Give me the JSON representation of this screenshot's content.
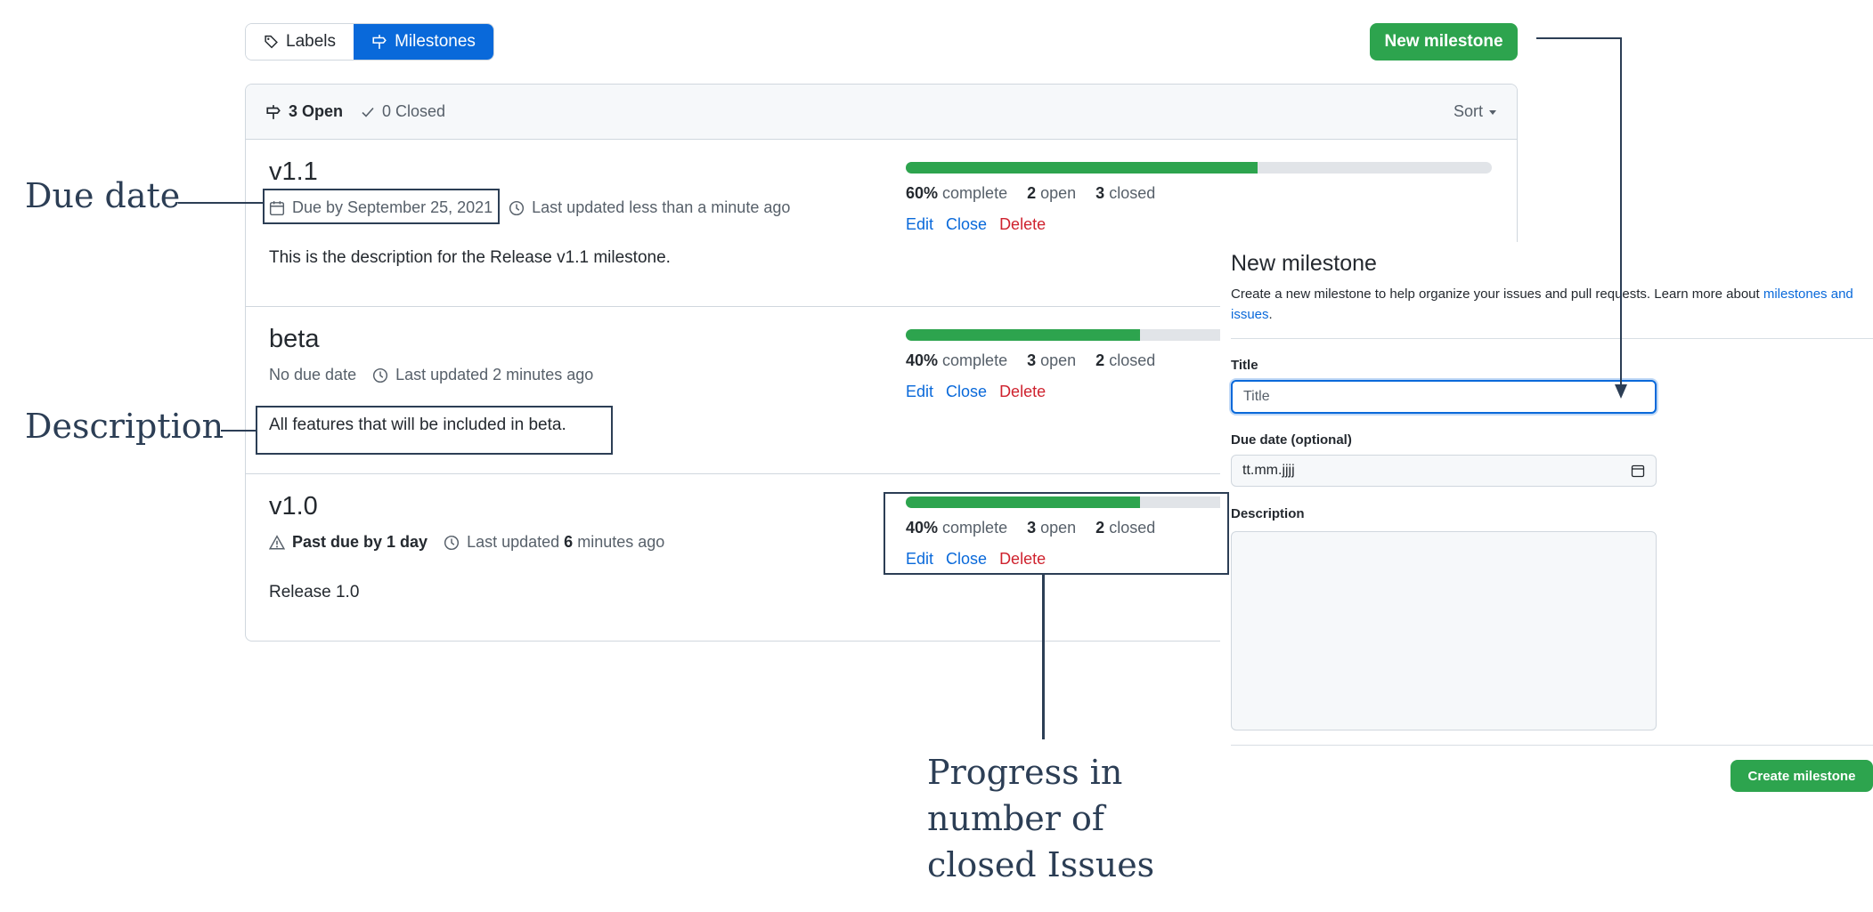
{
  "toggle": {
    "labels": "Labels",
    "milestones": "Milestones"
  },
  "new_milestone_button": "New milestone",
  "list_header": {
    "open": "3 Open",
    "closed": "0 Closed",
    "sort": "Sort"
  },
  "milestones": [
    {
      "title": "v1.1",
      "due": "Due by September 25, 2021",
      "updated": "Last updated less than a minute ago",
      "description": "This is the description for the Release v1.1 milestone.",
      "progress_pct": 60,
      "complete_pct": "60%",
      "complete_label": "complete",
      "open_count": "2",
      "open_label": "open",
      "closed_count": "3",
      "closed_label": "closed"
    },
    {
      "title": "beta",
      "due": "No due date",
      "updated": "Last updated 2 minutes ago",
      "description": "All features that will be included in beta.",
      "progress_pct": 40,
      "complete_pct": "40%",
      "complete_label": "complete",
      "open_count": "3",
      "open_label": "open",
      "closed_count": "2",
      "closed_label": "closed"
    },
    {
      "title": "v1.0",
      "due": "Past due by 1 day",
      "updated_prefix": "Last updated",
      "updated_bold": "6",
      "updated_suffix": "minutes ago",
      "description": "Release 1.0",
      "progress_pct": 40,
      "complete_pct": "40%",
      "complete_label": "complete",
      "open_count": "3",
      "open_label": "open",
      "closed_count": "2",
      "closed_label": "closed"
    }
  ],
  "actions": {
    "edit": "Edit",
    "close": "Close",
    "delete": "Delete"
  },
  "annotations": {
    "due_date": "Due date",
    "description": "Description",
    "progress": [
      "Progress in",
      "number of",
      "closed Issues"
    ]
  },
  "new_milestone_form": {
    "heading": "New milestone",
    "subtitle": "Create a new milestone to help organize your issues and pull requests. Learn more about",
    "subtitle_link": "milestones and issues",
    "subtitle_end": ".",
    "title_label": "Title",
    "title_placeholder": "Title",
    "due_label": "Due date (optional)",
    "due_placeholder": "tt.mm.jjjj",
    "description_label": "Description",
    "create_button": "Create milestone"
  },
  "colors": {
    "accent": "#0969da",
    "green": "#2da44e",
    "danger": "#cf222e",
    "annotation": "#2c3e55"
  }
}
